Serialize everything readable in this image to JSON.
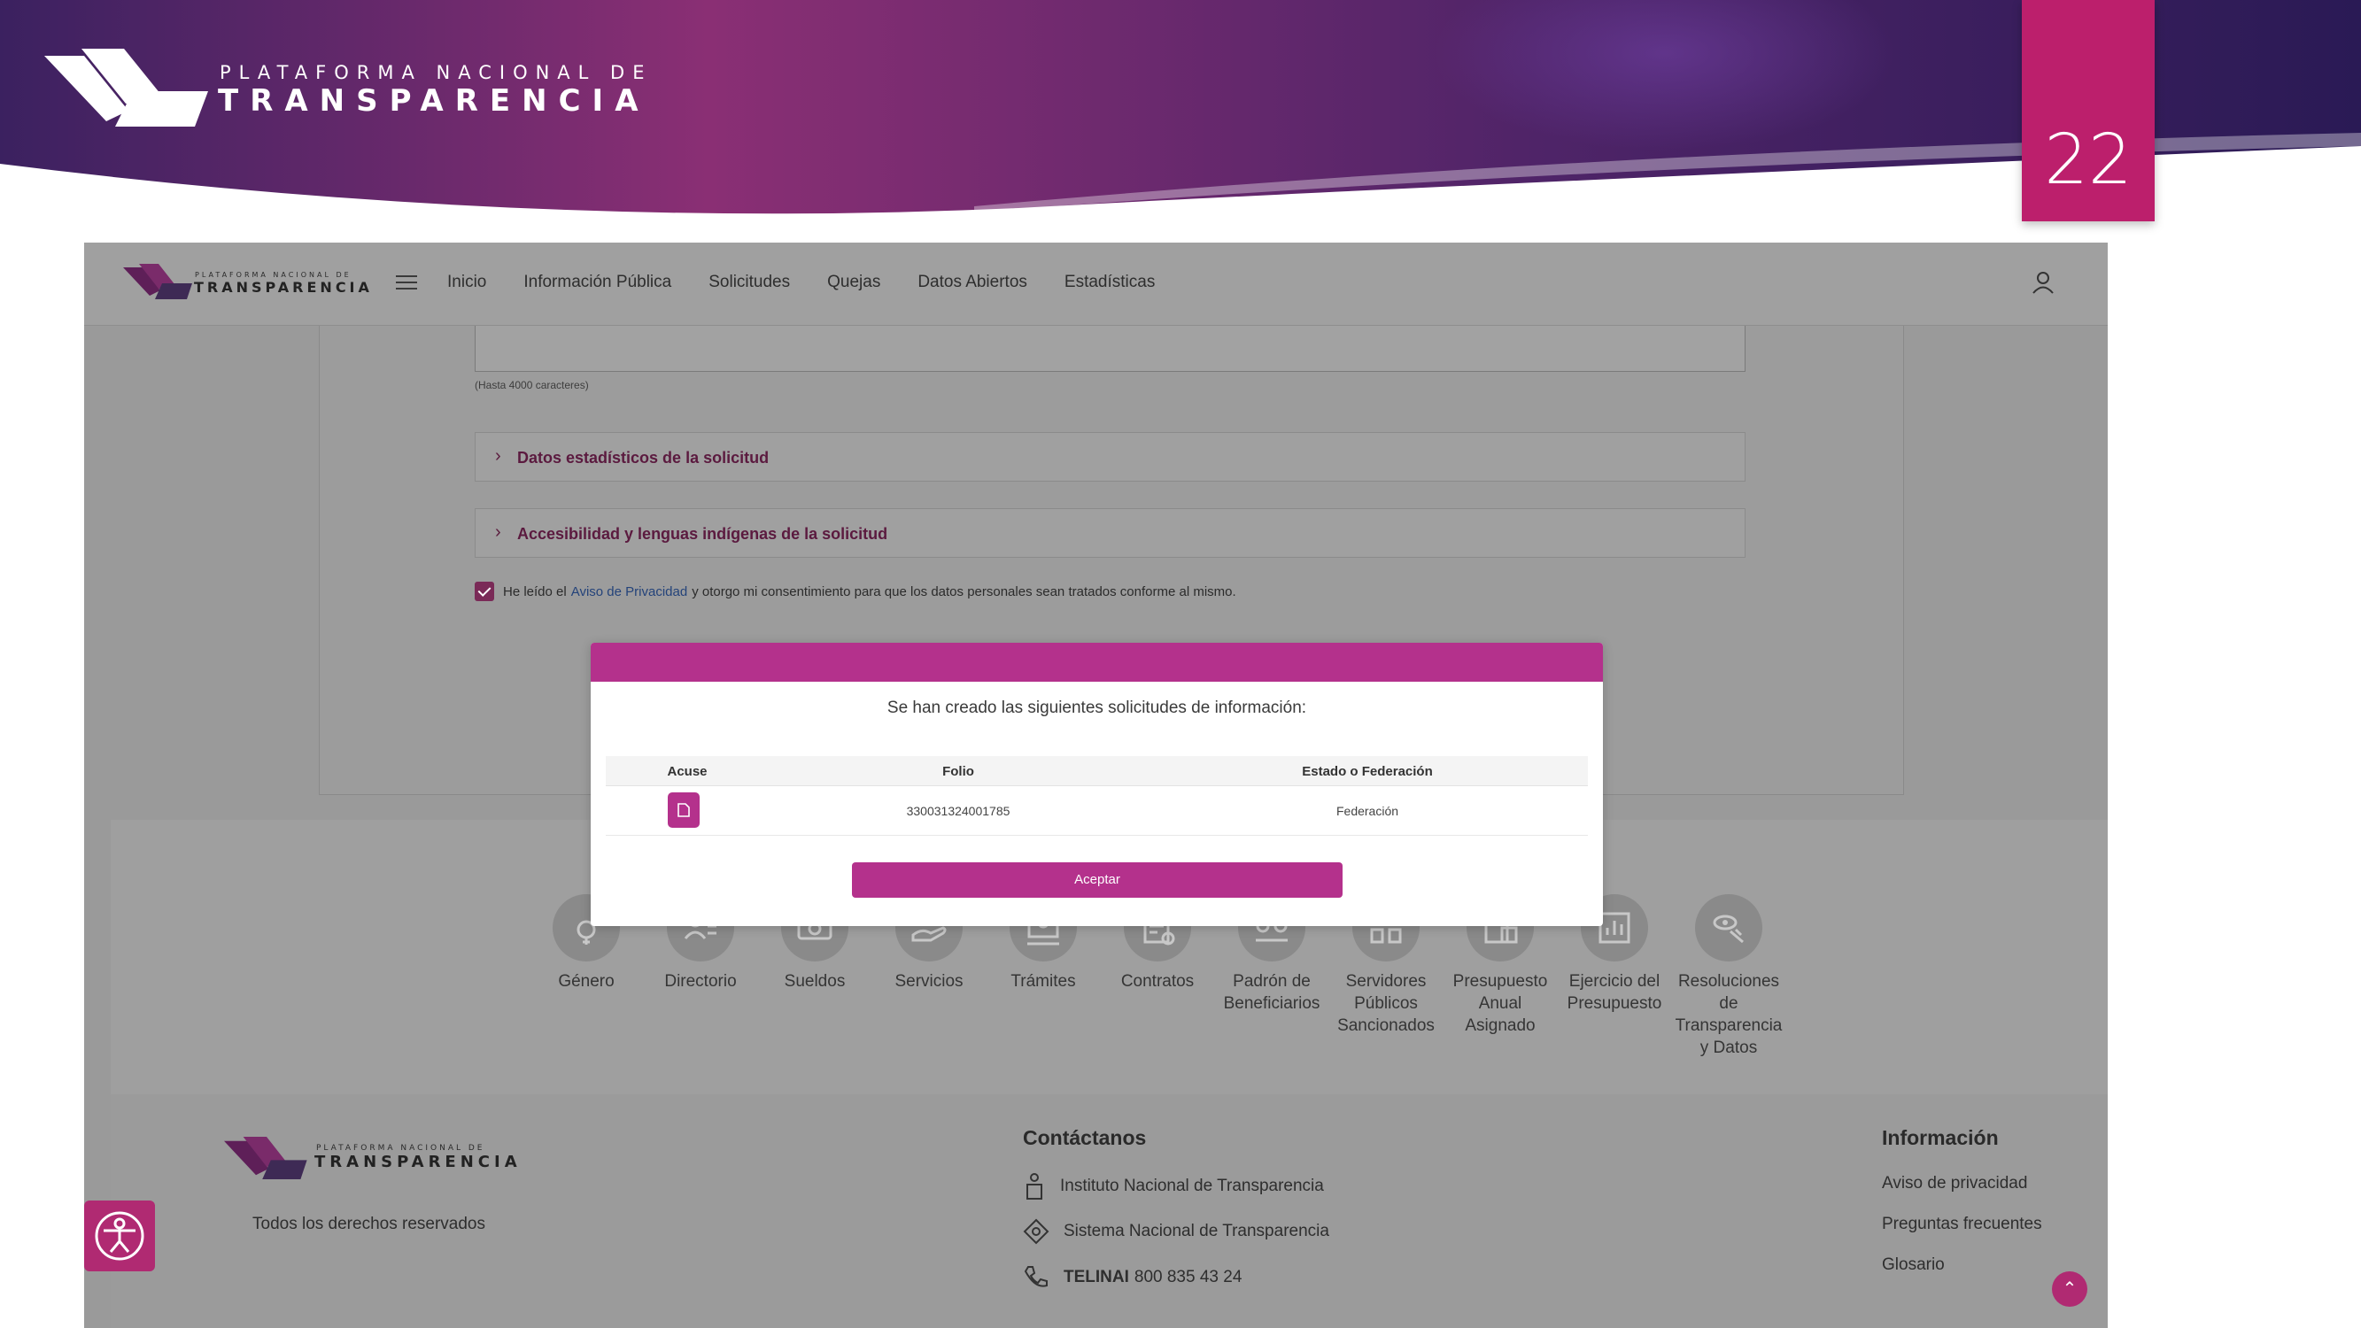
{
  "slide": {
    "brand_top": "PLATAFORMA NACIONAL DE",
    "brand_main": "TRANSPARENCIA",
    "page_number": "22"
  },
  "navbar": {
    "logo_top": "PLATAFORMA NACIONAL DE",
    "logo_main": "TRANSPARENCIA",
    "items": [
      "Inicio",
      "Información Pública",
      "Solicitudes",
      "Quejas",
      "Datos Abiertos",
      "Estadísticas"
    ]
  },
  "form": {
    "char_hint": "(Hasta 4000 caracteres)",
    "accordion_stats": "Datos estadísticos de la solicitud",
    "accordion_accessibility": "Accesibilidad y lenguas indígenas de la solicitud",
    "consent_prefix": "He leído el",
    "consent_link": "Aviso de Privacidad",
    "consent_suffix": "y otorgo mi consentimiento para que los datos personales sean tratados conforme al mismo.",
    "consent_checked": true
  },
  "modal": {
    "message": "Se han creado las siguientes solicitudes de información:",
    "columns": [
      "Acuse",
      "Folio",
      "Estado o Federación"
    ],
    "rows": [
      {
        "folio": "330031324001785",
        "estado": "Federación"
      }
    ],
    "accept_label": "Aceptar",
    "accent_color": "#b4318c"
  },
  "icons": [
    {
      "label": "Género",
      "icon": "gender-icon"
    },
    {
      "label": "Directorio",
      "icon": "directory-icon"
    },
    {
      "label": "Sueldos",
      "icon": "salary-icon"
    },
    {
      "label": "Servicios",
      "icon": "services-icon"
    },
    {
      "label": "Trámites",
      "icon": "procedures-icon"
    },
    {
      "label": "Contratos",
      "icon": "contracts-icon"
    },
    {
      "label": "Padrón de\nBeneficiarios",
      "icon": "beneficiaries-icon"
    },
    {
      "label": "Servidores\nPúblicos\nSancionados",
      "icon": "sanctioned-servants-icon"
    },
    {
      "label": "Presupuesto\nAnual\nAsignado",
      "icon": "budget-icon"
    },
    {
      "label": "Ejercicio del\nPresupuesto",
      "icon": "budget-execution-icon"
    },
    {
      "label": "Resoluciones\nde\nTransparencia\ny Datos",
      "icon": "resolutions-icon"
    }
  ],
  "footer": {
    "logo_top": "PLATAFORMA NACIONAL DE",
    "logo_main": "TRANSPARENCIA",
    "rights": "Todos los derechos reservados",
    "contact_heading": "Contáctanos",
    "contact_inst": "Instituto Nacional de Transparencia",
    "contact_sistema": "Sistema Nacional de Transparencia",
    "contact_phone_label": "TELINAI",
    "contact_phone": "800 835 43 24",
    "info_heading": "Información",
    "info_links": [
      "Aviso de privacidad",
      "Preguntas frecuentes",
      "Glosario"
    ]
  }
}
